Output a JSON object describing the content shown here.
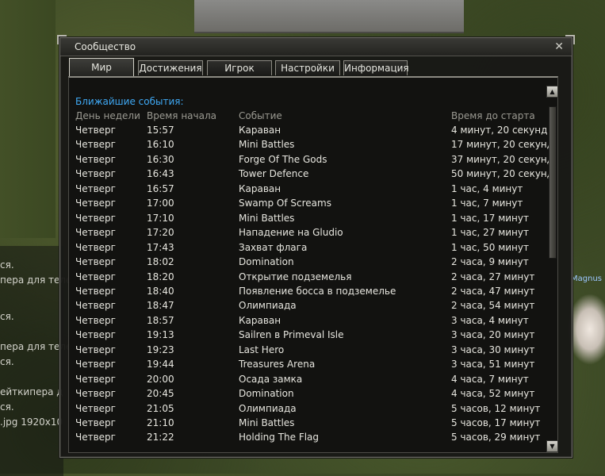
{
  "window": {
    "title": "Сообщество",
    "close_glyph": "✕"
  },
  "tabs": [
    {
      "label": "Мир",
      "active": true
    },
    {
      "label": "Достижения",
      "active": false
    },
    {
      "label": "Игрок",
      "active": false
    },
    {
      "label": "Настройки",
      "active": false
    },
    {
      "label": "Информация",
      "active": false
    }
  ],
  "events": {
    "section_title": "Ближайшие события:",
    "headers": [
      "День недели",
      "Время начала",
      "Событие",
      "Время до старта"
    ],
    "rows": [
      [
        "Четверг",
        "15:57",
        "Караван",
        "4 минут, 20 секунд"
      ],
      [
        "Четверг",
        "16:10",
        "Mini Battles",
        "17 минут, 20 секунд"
      ],
      [
        "Четверг",
        "16:30",
        "Forge Of The Gods",
        "37 минут, 20 секунд"
      ],
      [
        "Четверг",
        "16:43",
        "Tower Defence",
        "50 минут, 20 секунд"
      ],
      [
        "Четверг",
        "16:57",
        "Караван",
        "1 час, 4 минут"
      ],
      [
        "Четверг",
        "17:00",
        "Swamp Of Screams",
        "1 час, 7 минут"
      ],
      [
        "Четверг",
        "17:10",
        "Mini Battles",
        "1 час, 17 минут"
      ],
      [
        "Четверг",
        "17:20",
        "Нападение на Gludio",
        "1 час, 27 минут"
      ],
      [
        "Четверг",
        "17:43",
        "Захват флага",
        "1 час, 50 минут"
      ],
      [
        "Четверг",
        "18:02",
        "Domination",
        "2 часа, 9 минут"
      ],
      [
        "Четверг",
        "18:20",
        "Открытие подземелья",
        "2 часа, 27 минут"
      ],
      [
        "Четверг",
        "18:40",
        "Появление босса в подземелье",
        "2 часа, 47 минут"
      ],
      [
        "Четверг",
        "18:47",
        "Олимпиада",
        "2 часа, 54 минут"
      ],
      [
        "Четверг",
        "18:57",
        "Караван",
        "3 часа, 4 минут"
      ],
      [
        "Четверг",
        "19:13",
        "Sailren в Primeval Isle",
        "3 часа, 20 минут"
      ],
      [
        "Четверг",
        "19:23",
        "Last Hero",
        "3 часа, 30 минут"
      ],
      [
        "Четверг",
        "19:44",
        "Treasures Arena",
        "3 часа, 51 минут"
      ],
      [
        "Четверг",
        "20:00",
        "Осада замка",
        "4 часа, 7 минут"
      ],
      [
        "Четверг",
        "20:45",
        "Domination",
        "4 часа, 52 минут"
      ],
      [
        "Четверг",
        "21:05",
        "Олимпиада",
        "5 часов, 12 минут"
      ],
      [
        "Четверг",
        "21:10",
        "Mini Battles",
        "5 часов, 17 минут"
      ],
      [
        "Четверг",
        "21:22",
        "Holding The Flag",
        "5 часов, 29 минут"
      ]
    ]
  },
  "scrollbar": {
    "up_glyph": "▲",
    "down_glyph": "▼"
  },
  "background_chat": {
    "lines": [
      "ся.",
      "пера для теле",
      "ся.",
      "пера для теле",
      "ся.",
      "ейткипера д",
      "ся.",
      ".jpg 1920x10"
    ]
  },
  "background_name": "Magnus"
}
